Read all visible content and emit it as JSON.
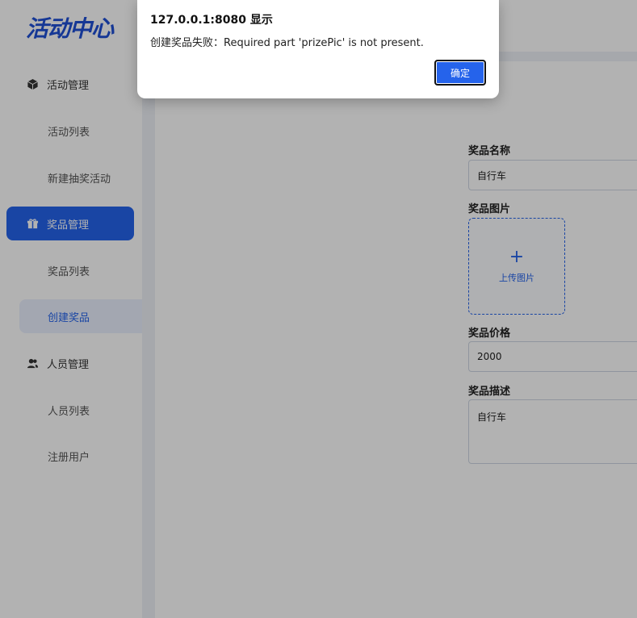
{
  "sidebar": {
    "logo": "活动中心",
    "groups": [
      {
        "label": "活动管理",
        "icon": "cube-icon",
        "subs": [
          "活动列表",
          "新建抽奖活动"
        ]
      },
      {
        "label": "奖品管理",
        "icon": "gift-icon",
        "subs": [
          "奖品列表",
          "创建奖品"
        ]
      },
      {
        "label": "人员管理",
        "icon": "users-icon",
        "subs": [
          "人员列表",
          "注册用户"
        ]
      }
    ]
  },
  "form": {
    "name_label": "奖品名称",
    "name_value": "自行车",
    "pic_label": "奖品图片",
    "upload_plus": "+",
    "upload_text": "上传图片",
    "price_label": "奖品价格",
    "price_value": "2000",
    "desc_label": "奖品描述",
    "desc_value": "自行车"
  },
  "dialog": {
    "title": "127.0.0.1:8080 显示",
    "message": "创建奖品失败：Required part 'prizePic' is not present.",
    "ok_label": "确定"
  },
  "colors": {
    "accent": "#2563eb",
    "overlay": "rgba(0,0,0,0.30)"
  }
}
